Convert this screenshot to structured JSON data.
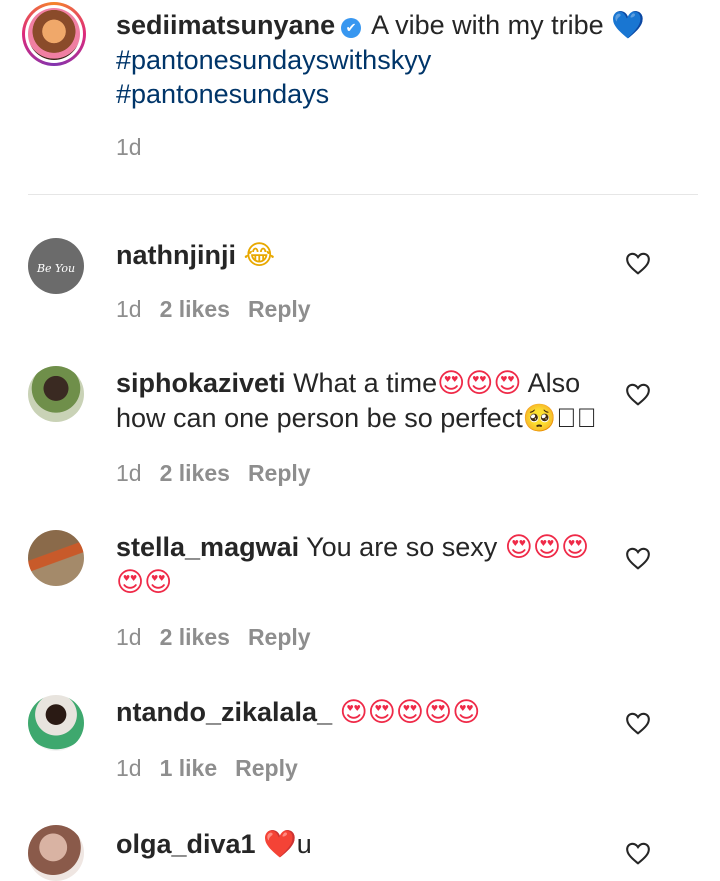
{
  "caption": {
    "username": "sediimatsunyane",
    "verified_badge": "✔",
    "text": "A vibe with my tribe",
    "heart_emoji": "💙",
    "hashtag1": "#pantonesundayswithskyy",
    "hashtag2": "#pantonesundays",
    "time": "1d"
  },
  "avatar_texts": {
    "nathnjinji": "Be You"
  },
  "comments": [
    {
      "username": "nathnjinji",
      "text": "",
      "emoji": "😂",
      "time": "1d",
      "likes": "2 likes",
      "reply": "Reply"
    },
    {
      "username": "siphokaziveti",
      "text": "What a time",
      "emoji": "😍😍😍",
      "text2": "Also how can one person be so perfect",
      "emoji2": "🥺",
      "tail": "󿶿󿶿",
      "time": "1d",
      "likes": "2 likes",
      "reply": "Reply"
    },
    {
      "username": "stella_magwai",
      "text": "You are so sexy",
      "emoji": "😍😍😍",
      "emoji2": "😍😍",
      "time": "1d",
      "likes": "2 likes",
      "reply": "Reply"
    },
    {
      "username": "ntando_zikalala_",
      "text": "",
      "emoji": "😍😍😍😍😍",
      "time": "1d",
      "likes": "1 like",
      "reply": "Reply"
    },
    {
      "username": "olga_diva1",
      "emoji": "❤️",
      "text": "u"
    }
  ],
  "icons": {
    "like": "heart-outline-icon"
  }
}
